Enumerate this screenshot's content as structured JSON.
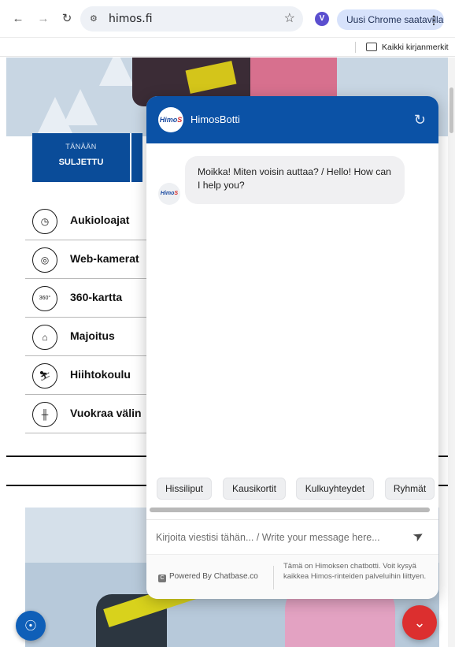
{
  "browser": {
    "url": "himos.fi",
    "profile_initial": "V",
    "update_label": "Uusi Chrome saatavilla",
    "bookmarks_label": "Kaikki kirjanmerkit"
  },
  "page": {
    "status_tab": {
      "label_top": "TÄNÄÄN",
      "label_main": "SULJETTU"
    },
    "menu": [
      {
        "label": "Aukioloajat",
        "icon": "clock-icon",
        "glyph": "◷"
      },
      {
        "label": "Web-kamerat",
        "icon": "webcam-icon",
        "glyph": "◎"
      },
      {
        "label": "360-kartta",
        "icon": "360-map-icon",
        "glyph": "360°"
      },
      {
        "label": "Majoitus",
        "icon": "house-icon",
        "glyph": "⌂"
      },
      {
        "label": "Hiihtokoulu",
        "icon": "ski-school-icon",
        "glyph": "⛷"
      },
      {
        "label": "Vuokraa välin",
        "icon": "rental-icon",
        "glyph": "╫"
      }
    ]
  },
  "chat": {
    "bot_name": "HimosBotti",
    "avatar_text": "Himo",
    "avatar_s": "S",
    "message": "Moikka! Miten voisin auttaa? / Hello! How can I help you?",
    "chips": [
      "Hissiliput",
      "Kausikortit",
      "Kulkuyhteydet",
      "Ryhmät"
    ],
    "input_placeholder": "Kirjoita viestisi tähän... / Write your message here...",
    "powered_by": "Powered By Chatbase.co",
    "disclaimer": "Tämä on Himoksen chatbotti. Voit kysyä kaikkea Himos-rinteiden palveluihin liittyen."
  },
  "colors": {
    "accent": "#0b52a6",
    "chat_toggle": "#dc2f2f",
    "fingerprint_button": "#0f5fb8"
  }
}
